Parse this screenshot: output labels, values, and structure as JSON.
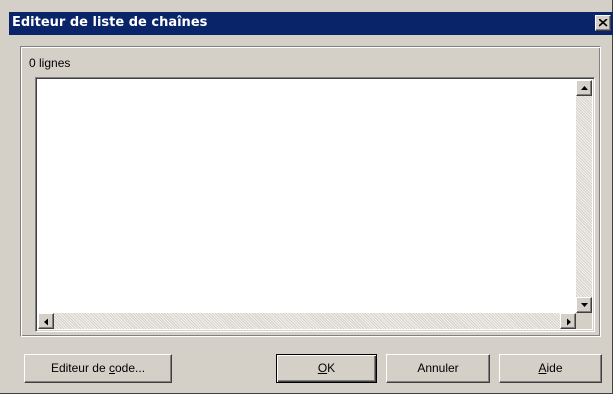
{
  "window": {
    "title": "Editeur de liste de chaînes"
  },
  "editor": {
    "line_count": "0 lignes",
    "content": ""
  },
  "buttons": {
    "code_editor": {
      "before": "Editeur de ",
      "accel": "c",
      "after": "ode..."
    },
    "ok": {
      "before": "",
      "accel": "O",
      "after": "K"
    },
    "cancel": {
      "before": "Annuler",
      "accel": "",
      "after": ""
    },
    "help": {
      "before": "",
      "accel": "A",
      "after": "ide"
    }
  },
  "colors": {
    "title_bar": "#0a246a",
    "face": "#d4d0c8",
    "memo_bg": "#ffffff"
  },
  "icons": {
    "close": "close-icon",
    "scroll_up": "arrow-up-icon",
    "scroll_down": "arrow-down-icon",
    "scroll_left": "arrow-left-icon",
    "scroll_right": "arrow-right-icon"
  }
}
